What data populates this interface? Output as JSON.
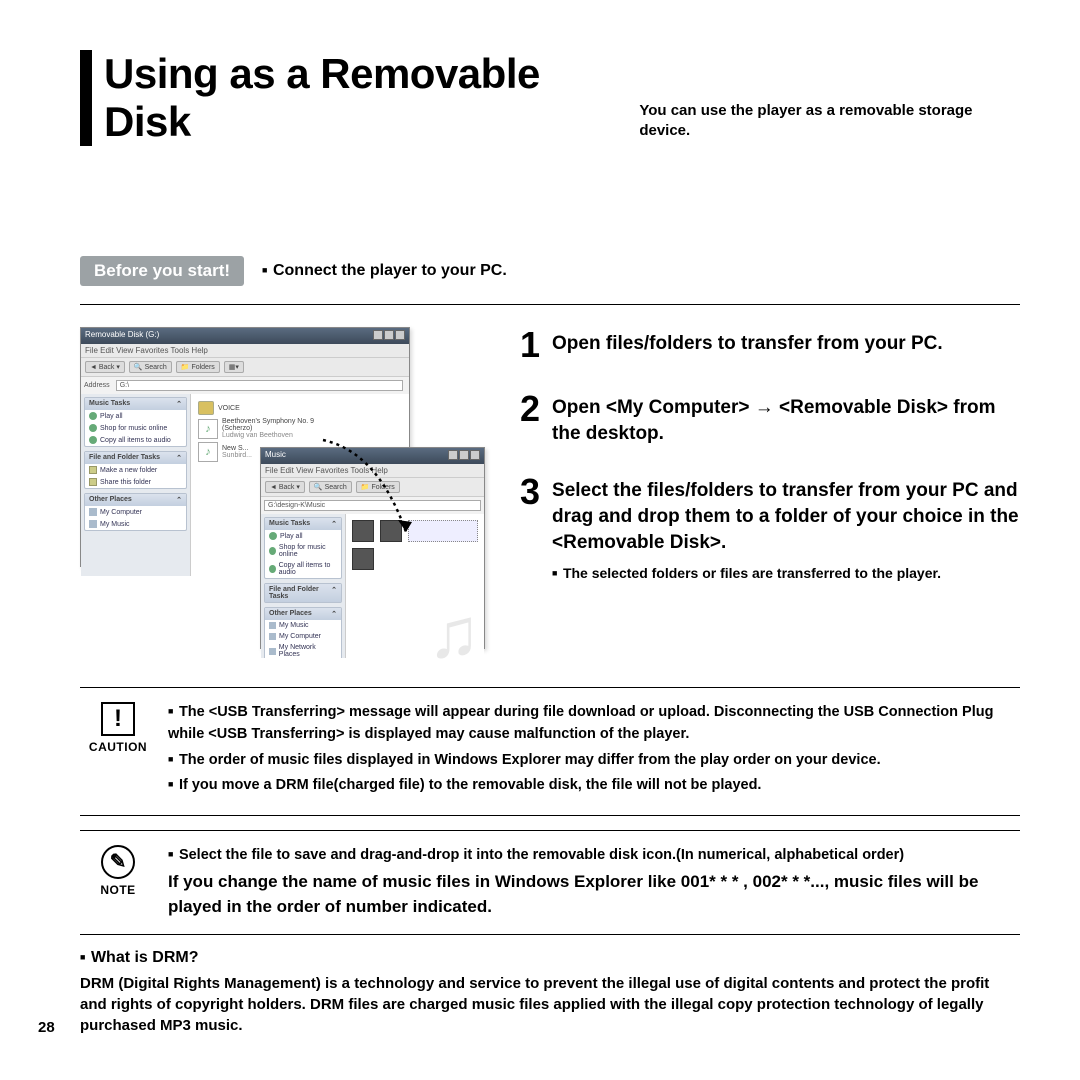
{
  "page_number": "28",
  "title": {
    "main": "Using as a Removable Disk",
    "sub": "You can use the player as a removable storage device."
  },
  "before": {
    "badge": "Before you start!",
    "text": "Connect the player to your PC."
  },
  "screenshot": {
    "win1": {
      "title": "Removable Disk (G:)",
      "menu": "File   Edit   View   Favorites   Tools   Help",
      "back": "Back",
      "search": "Search",
      "folders": "Folders",
      "address_label": "Address",
      "address_value": "G:\\",
      "panel": {
        "music_tasks": "Music Tasks",
        "music_items": [
          "Play all",
          "Shop for music online",
          "Copy all items to audio"
        ],
        "file_tasks": "File and Folder Tasks",
        "file_items": [
          "Make a new folder",
          "Share this folder"
        ],
        "other_places": "Other Places",
        "other_items": [
          "My Computer",
          "My Music"
        ]
      },
      "content": {
        "folder": "VOICE",
        "track1_line1": "Beethoven's Symphony No. 9",
        "track1_line2": "(Scherzo)",
        "track1_line3": "Ludwig van Beethoven",
        "track2_line1": "New S...",
        "track2_line2": "Sunbird..."
      }
    },
    "win2": {
      "title": "Music",
      "menu": "File   Edit   View   Favorites   Tools   Help",
      "back": "Back",
      "search": "Search",
      "folders": "Folders",
      "address_value": "G:\\design-K\\Music",
      "panel": {
        "music_tasks": "Music Tasks",
        "music_items": [
          "Play all",
          "Shop for music online",
          "Copy all items to audio"
        ],
        "file_tasks": "File and Folder Tasks",
        "other_places": "Other Places",
        "other_items": [
          "My Music",
          "My Computer",
          "My Network Places"
        ]
      }
    }
  },
  "steps": [
    {
      "num": "1",
      "text": "Open files/folders to transfer from your PC."
    },
    {
      "num": "2",
      "text": "Open <My Computer> → <Removable Disk> from the desktop."
    },
    {
      "num": "3",
      "text": "Select the files/folders to transfer from your PC and drag and drop them to a folder of your choice in the <Removable Disk>.",
      "sub": "The selected folders or files are transferred to the player."
    }
  ],
  "caution": {
    "label": "CAUTION",
    "items": [
      "The <USB Transferring> message will appear during file download or upload. Disconnecting the USB Connection Plug while <USB Transferring> is displayed may cause malfunction of the player.",
      "The order of music files displayed in Windows Explorer may differ from the play order on your device.",
      "If you move a DRM file(charged file)  to the removable disk, the file will not be played."
    ]
  },
  "note": {
    "label": "NOTE",
    "lead": "Select the file to save and drag-and-drop it into the removable disk icon.(In numerical, alphabetical order)",
    "body": "If you change the name of music files in Windows Explorer like 001* * * , 002* * *..., music files will be played in the order of number indicated."
  },
  "drm": {
    "title": "What is DRM?",
    "body": "DRM (Digital Rights Management) is a technology and service to prevent the illegal use of digital contents and protect the profit and rights of copyright holders. DRM files are charged music files applied with the illegal copy protection technology of legally purchased MP3 music."
  }
}
